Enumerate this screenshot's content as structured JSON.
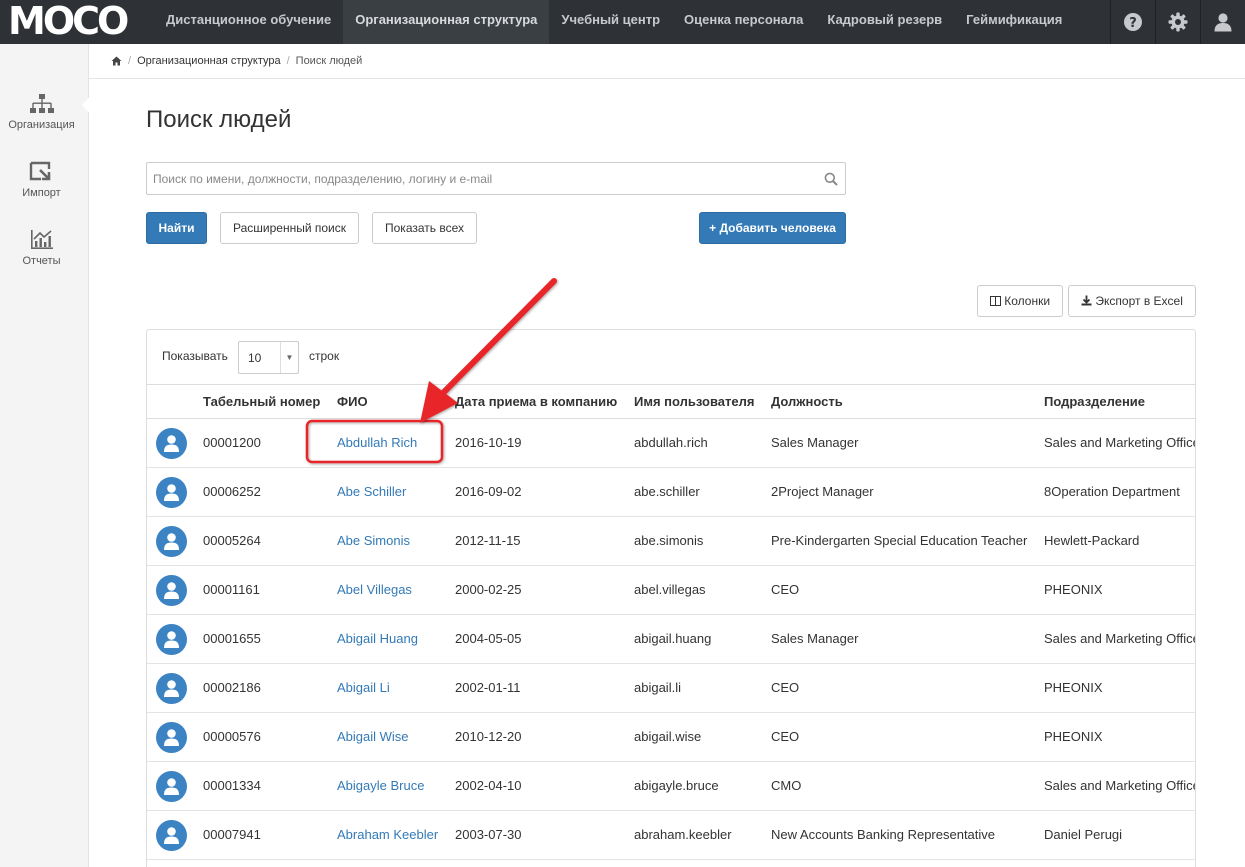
{
  "header": {
    "logo": "MOCO",
    "nav": [
      {
        "label": "Дистанционное обучение",
        "active": false
      },
      {
        "label": "Организационная структура",
        "active": true
      },
      {
        "label": "Учебный центр",
        "active": false
      },
      {
        "label": "Оценка персонала",
        "active": false
      },
      {
        "label": "Кадровый резерв",
        "active": false
      },
      {
        "label": "Геймификация",
        "active": false
      }
    ],
    "icons": [
      "help-icon",
      "gear-icon",
      "user-icon"
    ]
  },
  "sidebar": {
    "items": [
      {
        "label": "Организация",
        "icon": "org-chart-icon"
      },
      {
        "label": "Импорт",
        "icon": "import-icon"
      },
      {
        "label": "Отчеты",
        "icon": "chart-icon"
      }
    ]
  },
  "breadcrumb": {
    "home_icon": "home-icon",
    "items": [
      "Организационная структура",
      "Поиск людей"
    ]
  },
  "page": {
    "title": "Поиск людей"
  },
  "search": {
    "placeholder": "Поиск по имени, должности, подразделению, логину и e-mail",
    "value": ""
  },
  "buttons": {
    "find": "Найти",
    "advanced": "Расширенный поиск",
    "show_all": "Показать всех",
    "add_person": "Добавить человека",
    "columns": "Колонки",
    "export": "Экспорт в Excel"
  },
  "table": {
    "length_label_before": "Показывать",
    "length_value": "10",
    "length_label_after": "строк",
    "columns": [
      "Табельный номер",
      "ФИО",
      "Дата приема в компанию",
      "Имя пользователя",
      "Должность",
      "Подразделение"
    ],
    "rows": [
      {
        "id": "00001200",
        "name": "Abdullah Rich",
        "date": "2016-10-19",
        "username": "abdullah.rich",
        "position": "Sales Manager",
        "department": "Sales and Marketing Office"
      },
      {
        "id": "00006252",
        "name": "Abe Schiller",
        "date": "2016-09-02",
        "username": "abe.schiller",
        "position": "2Project Manager",
        "department": "8Operation Department"
      },
      {
        "id": "00005264",
        "name": "Abe Simonis",
        "date": "2012-11-15",
        "username": "abe.simonis",
        "position": "Pre-Kindergarten Special Education Teacher",
        "department": "Hewlett-Packard"
      },
      {
        "id": "00001161",
        "name": "Abel Villegas",
        "date": "2000-02-25",
        "username": "abel.villegas",
        "position": "CEO",
        "department": "PHEONIX"
      },
      {
        "id": "00001655",
        "name": "Abigail Huang",
        "date": "2004-05-05",
        "username": "abigail.huang",
        "position": "Sales Manager",
        "department": "Sales and Marketing Office"
      },
      {
        "id": "00002186",
        "name": "Abigail Li",
        "date": "2002-01-11",
        "username": "abigail.li",
        "position": "CEO",
        "department": "PHEONIX"
      },
      {
        "id": "00000576",
        "name": "Abigail Wise",
        "date": "2010-12-20",
        "username": "abigail.wise",
        "position": "CEO",
        "department": "PHEONIX"
      },
      {
        "id": "00001334",
        "name": "Abigayle Bruce",
        "date": "2002-04-10",
        "username": "abigayle.bruce",
        "position": "CMO",
        "department": "Sales and Marketing Office"
      },
      {
        "id": "00007941",
        "name": "Abraham Keebler",
        "date": "2003-07-30",
        "username": "abraham.keebler",
        "position": "New Accounts Banking Representative",
        "department": "Daniel Perugi"
      }
    ]
  },
  "annotation": {
    "color": "#e8262b",
    "highlight": "Abdullah Rich"
  }
}
